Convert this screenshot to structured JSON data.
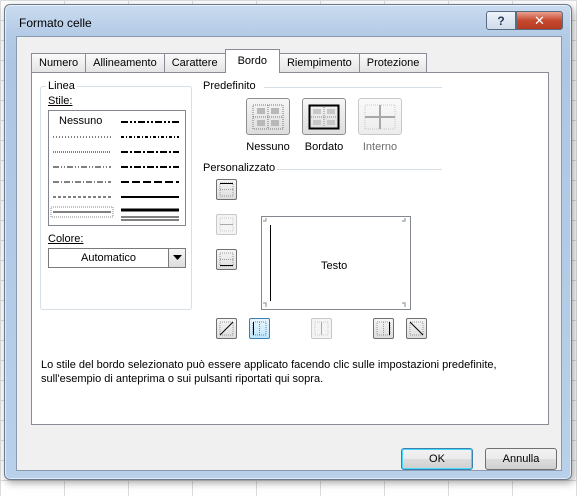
{
  "dialog": {
    "title": "Formato celle",
    "help_label": "?",
    "close_label": "✕"
  },
  "tabs": [
    {
      "label": "Numero"
    },
    {
      "label": "Allineamento"
    },
    {
      "label": "Carattere"
    },
    {
      "label": "Bordo",
      "active": true
    },
    {
      "label": "Riempimento"
    },
    {
      "label": "Protezione"
    }
  ],
  "linea": {
    "group_title": "Linea",
    "style_label": "Stile:",
    "style_none_label": "Nessuno",
    "color_label": "Colore:",
    "color_value": "Automatico"
  },
  "predefinito": {
    "title": "Predefinito",
    "buttons": [
      {
        "label": "Nessuno",
        "icon": "border-none-icon",
        "enabled": true
      },
      {
        "label": "Bordato",
        "icon": "border-outline-icon",
        "enabled": true
      },
      {
        "label": "Interno",
        "icon": "border-inside-icon",
        "enabled": false
      }
    ]
  },
  "personalizzato": {
    "title": "Personalizzato",
    "preview_text": "Testo"
  },
  "description": "Lo stile del bordo selezionato può essere applicato facendo clic sulle impostazioni predefinite, sull'esempio di anteprima o sui pulsanti riportati qui sopra.",
  "footer": {
    "ok_label": "OK",
    "cancel_label": "Annulla"
  },
  "colors": {
    "accent_blue": "#3c7fb1",
    "disabled_text": "#6d6d6d"
  }
}
